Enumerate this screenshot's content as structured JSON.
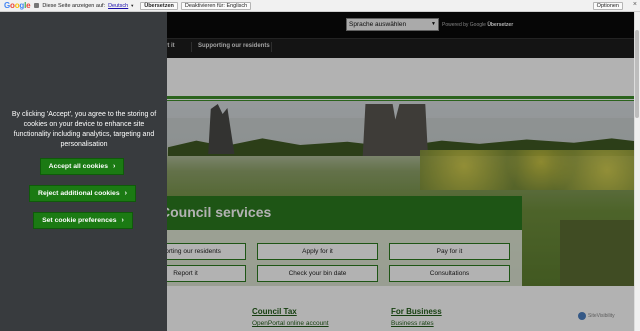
{
  "translate_bar": {
    "logo": [
      "G",
      "o",
      "o",
      "g",
      "l",
      "e"
    ],
    "message": "Diese Seite anzeigen auf:",
    "language": "Deutsch",
    "translate_button": "Übersetzen",
    "disable_button": "Deaktivieren für: Englisch",
    "options_button": "Optionen",
    "close_glyph": "×"
  },
  "header": {
    "language_select": "Sprache auswählen",
    "powered_by_prefix": "Powered by",
    "powered_by_google": "Google",
    "powered_by_suffix": "Übersetzer",
    "nav_items": [
      "Report it",
      "Supporting our residents"
    ]
  },
  "hero": {
    "services_title": "Council services",
    "service_buttons": [
      "Supporting our residents",
      "Apply for it",
      "Pay for it",
      "Report it",
      "Check your bin date",
      "Consultations"
    ]
  },
  "footer": {
    "columns": [
      {
        "heading": "Council Tax",
        "link": "OpenPortal online account"
      },
      {
        "heading": "For Business",
        "link": "Business rates"
      }
    ],
    "badge_text": "SiteVisibility"
  },
  "cookie_banner": {
    "message": "By clicking 'Accept', you agree to the storing of cookies on your device to enhance site functionality including analytics, targeting and personalisation",
    "accept_label": "Accept all cookies",
    "reject_label": "Reject additional cookies",
    "preferences_label": "Set cookie preferences"
  },
  "colors": {
    "accent_green": "#1b7a13",
    "panel_background": "#383b3e"
  }
}
